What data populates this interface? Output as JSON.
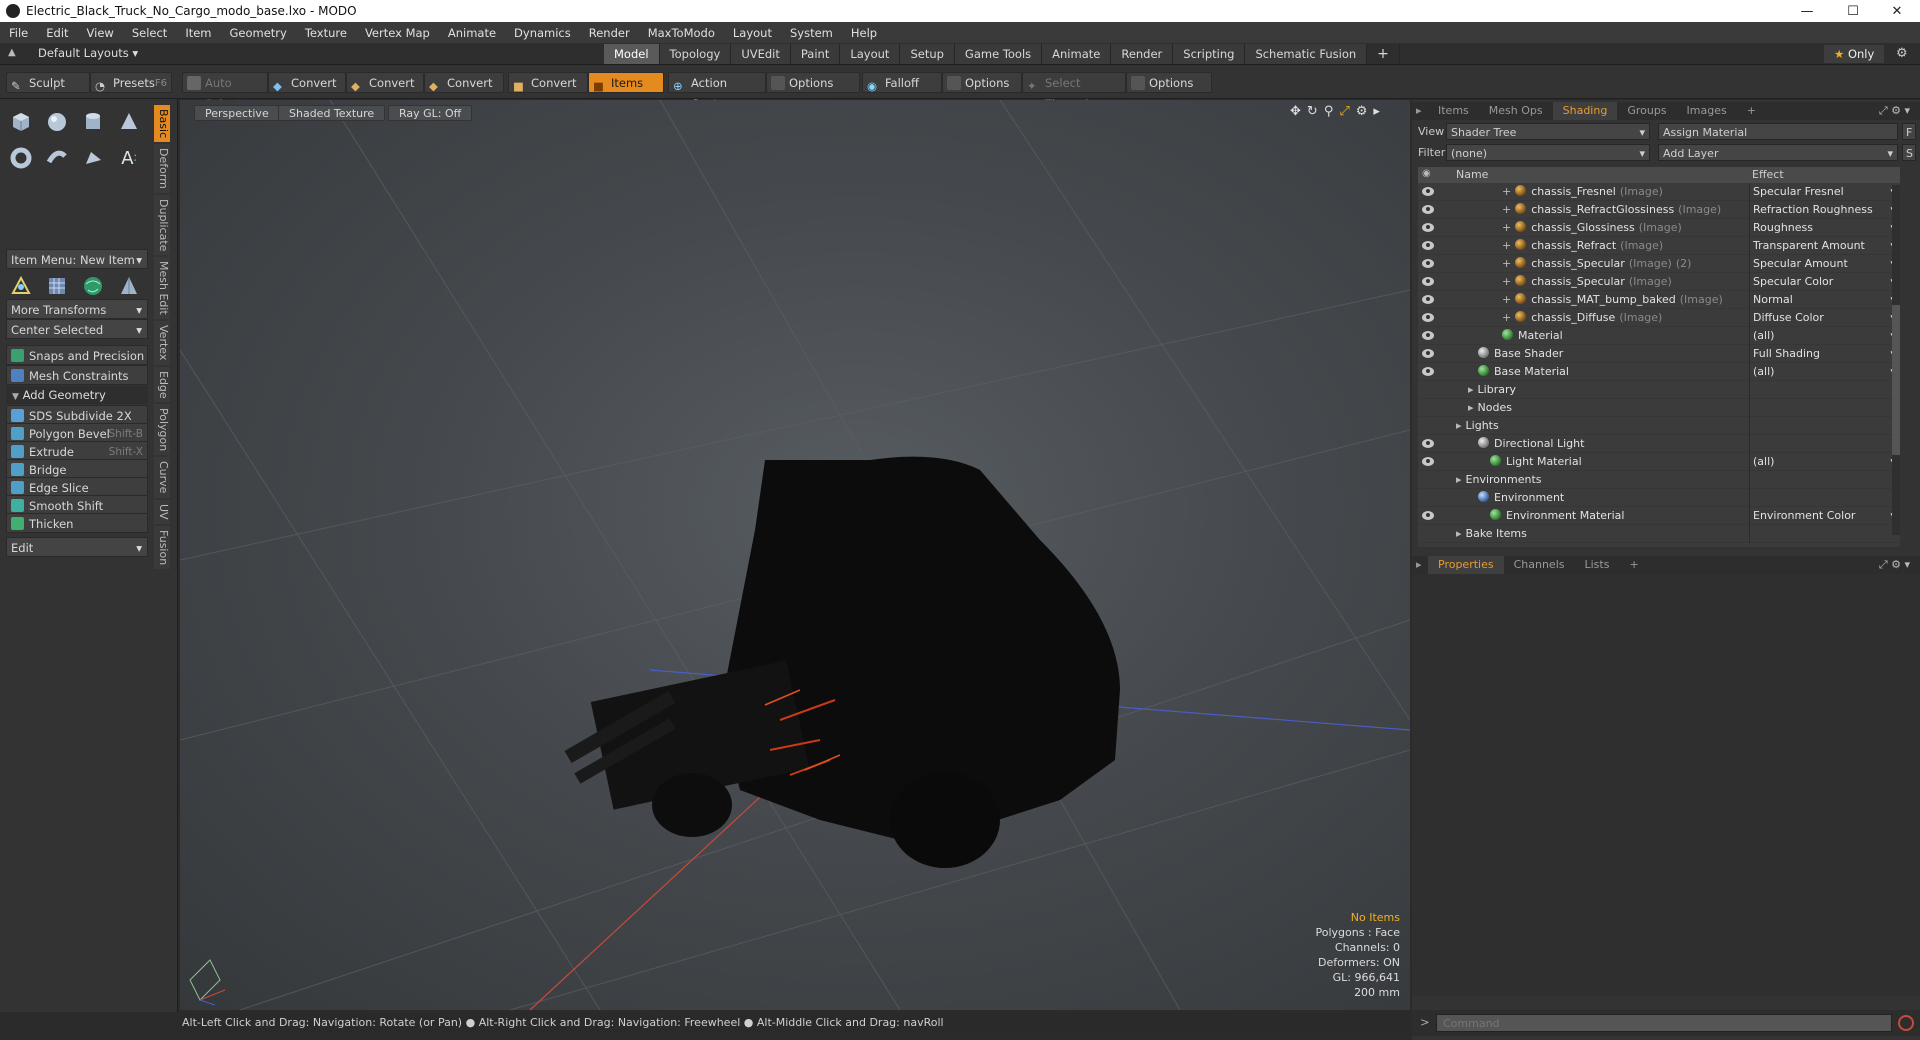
{
  "window": {
    "title": "Electric_Black_Truck_No_Cargo_modo_base.lxo - MODO",
    "controls": [
      "—",
      "☐",
      "✕"
    ]
  },
  "menu": [
    "File",
    "Edit",
    "View",
    "Select",
    "Item",
    "Geometry",
    "Texture",
    "Vertex Map",
    "Animate",
    "Dynamics",
    "Render",
    "MaxToModo",
    "Layout",
    "System",
    "Help"
  ],
  "layout_bar": {
    "layouts_label": "Default Layouts",
    "tabs": [
      "Model",
      "Topology",
      "UVEdit",
      "Paint",
      "Layout",
      "Setup",
      "Game Tools",
      "Animate",
      "Render",
      "Scripting",
      "Schematic Fusion"
    ],
    "active_tab": "Model",
    "add": "+",
    "only_label": "Only"
  },
  "toolbar": {
    "sculpt": "Sculpt",
    "presets": "Presets",
    "presets_key": "F6",
    "auto_select": "Auto Select",
    "convert1": "Convert",
    "convert2": "Convert",
    "convert3": "Convert",
    "convert4": "Convert",
    "items": "Items",
    "action_center": "Action Center",
    "options1": "Options",
    "falloff": "Falloff",
    "options2": "Options",
    "select_through": "Select Through",
    "options3": "Options"
  },
  "left_panel": {
    "item_menu": "Item Menu: New Item",
    "more_transforms": "More Transforms",
    "center_selected": "Center Selected",
    "snaps": "Snaps and Precision",
    "mesh_constraints": "Mesh Constraints",
    "add_geometry": "Add Geometry",
    "tools": [
      {
        "label": "SDS Subdivide 2X",
        "shortcut": "",
        "color": "#5aa0d8"
      },
      {
        "label": "Polygon Bevel",
        "shortcut": "Shift-B",
        "color": "#4fa0c8"
      },
      {
        "label": "Extrude",
        "shortcut": "Shift-X",
        "color": "#4fa0c8"
      },
      {
        "label": "Bridge",
        "shortcut": "",
        "color": "#4fa0c8"
      },
      {
        "label": "Edge Slice",
        "shortcut": "",
        "color": "#4fa0c8"
      },
      {
        "label": "Smooth Shift",
        "shortcut": "",
        "color": "#3fb0a0"
      },
      {
        "label": "Thicken",
        "shortcut": "",
        "color": "#3fb070"
      }
    ],
    "edit_dropdown": "Edit",
    "vertical_tabs": [
      "Basic",
      "Deform",
      "Duplicate",
      "Mesh Edit",
      "Vertex",
      "Edge",
      "Polygon",
      "Curve",
      "UV",
      "Fusion"
    ]
  },
  "viewport": {
    "view_mode": "Perspective",
    "shading": "Shaded Texture",
    "raygl": "Ray GL: Off",
    "hud": {
      "line1": "No Items",
      "line2": "Polygons : Face",
      "line3": "Channels: 0",
      "line4": "Deformers: ON",
      "line5": "GL: 966,641",
      "line6": "200 mm"
    }
  },
  "status_bar": "Alt-Left Click and Drag: Navigation: Rotate (or Pan) ●  Alt-Right Click and Drag: Navigation: Freewheel ●  Alt-Middle Click and Drag: navRoll",
  "right_panel": {
    "tabs": [
      "Items",
      "Mesh Ops",
      "Shading",
      "Groups",
      "Images",
      "+"
    ],
    "active_tab": "Shading",
    "view_label": "View",
    "view_value": "Shader Tree",
    "assign_material": "Assign Material",
    "assign_key": "F",
    "filter_label": "Filter",
    "filter_value": "(none)",
    "add_layer": "Add Layer",
    "add_key": "S",
    "col_name": "Name",
    "col_effect": "Effect",
    "rows": [
      {
        "name": "chassis_Fresnel",
        "suffix": "(Image)",
        "extra": "",
        "effect": "Specular Fresnel",
        "indent": 84,
        "icon": "img",
        "eye": true,
        "plus": true,
        "dd": true
      },
      {
        "name": "chassis_RefractGlossiness",
        "suffix": "(Image)",
        "extra": "",
        "effect": "Refraction Roughness",
        "indent": 84,
        "icon": "img",
        "eye": true,
        "plus": true,
        "dd": true
      },
      {
        "name": "chassis_Glossiness",
        "suffix": "(Image)",
        "extra": "",
        "effect": "Roughness",
        "indent": 84,
        "icon": "img",
        "eye": true,
        "plus": true,
        "dd": true
      },
      {
        "name": "chassis_Refract",
        "suffix": "(Image)",
        "extra": "",
        "effect": "Transparent Amount",
        "indent": 84,
        "icon": "img",
        "eye": true,
        "plus": true,
        "dd": true
      },
      {
        "name": "chassis_Specular",
        "suffix": "(Image)",
        "extra": "(2)",
        "effect": "Specular Amount",
        "indent": 84,
        "icon": "img",
        "eye": true,
        "plus": true,
        "dd": true
      },
      {
        "name": "chassis_Specular",
        "suffix": "(Image)",
        "extra": "",
        "effect": "Specular Color",
        "indent": 84,
        "icon": "img",
        "eye": true,
        "plus": true,
        "dd": true
      },
      {
        "name": "chassis_MAT_bump_baked",
        "suffix": "(Image)",
        "extra": "",
        "effect": "Normal",
        "indent": 84,
        "icon": "img",
        "eye": true,
        "plus": true,
        "dd": true
      },
      {
        "name": "chassis_Diffuse",
        "suffix": "(Image)",
        "extra": "",
        "effect": "Diffuse Color",
        "indent": 84,
        "icon": "img",
        "eye": true,
        "plus": true,
        "dd": true
      },
      {
        "name": "Material",
        "suffix": "",
        "extra": "",
        "effect": "(all)",
        "indent": 84,
        "icon": "mat",
        "eye": true,
        "plus": false,
        "dd": true
      },
      {
        "name": "Base Shader",
        "suffix": "",
        "extra": "",
        "effect": "Full Shading",
        "indent": 60,
        "icon": "grey",
        "eye": true,
        "plus": false,
        "dd": true
      },
      {
        "name": "Base Material",
        "suffix": "",
        "extra": "",
        "effect": "(all)",
        "indent": 60,
        "icon": "mat",
        "eye": true,
        "plus": false,
        "dd": true
      },
      {
        "name": "Library",
        "suffix": "",
        "extra": "",
        "effect": "",
        "indent": 50,
        "icon": "",
        "eye": false,
        "plus": false,
        "dd": false
      },
      {
        "name": "Nodes",
        "suffix": "",
        "extra": "",
        "effect": "",
        "indent": 50,
        "icon": "",
        "eye": false,
        "plus": false,
        "dd": false
      },
      {
        "name": "Lights",
        "suffix": "",
        "extra": "",
        "effect": "",
        "indent": 38,
        "icon": "",
        "eye": false,
        "plus": false,
        "dd": false
      },
      {
        "name": "Directional Light",
        "suffix": "",
        "extra": "",
        "effect": "",
        "indent": 60,
        "icon": "grey",
        "eye": true,
        "plus": false,
        "dd": false
      },
      {
        "name": "Light Material",
        "suffix": "",
        "extra": "",
        "effect": "(all)",
        "indent": 72,
        "icon": "mat",
        "eye": true,
        "plus": false,
        "dd": true
      },
      {
        "name": "Environments",
        "suffix": "",
        "extra": "",
        "effect": "",
        "indent": 38,
        "icon": "",
        "eye": false,
        "plus": false,
        "dd": false
      },
      {
        "name": "Environment",
        "suffix": "",
        "extra": "",
        "effect": "",
        "indent": 60,
        "icon": "env",
        "eye": false,
        "plus": false,
        "dd": false
      },
      {
        "name": "Environment Material",
        "suffix": "",
        "extra": "",
        "effect": "Environment Color",
        "indent": 72,
        "icon": "mat",
        "eye": true,
        "plus": false,
        "dd": true
      },
      {
        "name": "Bake Items",
        "suffix": "",
        "extra": "",
        "effect": "",
        "indent": 38,
        "icon": "",
        "eye": false,
        "plus": false,
        "dd": false
      }
    ],
    "props_tabs": [
      "Properties",
      "Channels",
      "Lists",
      "+"
    ],
    "props_active": "Properties",
    "command_placeholder": "Command"
  }
}
